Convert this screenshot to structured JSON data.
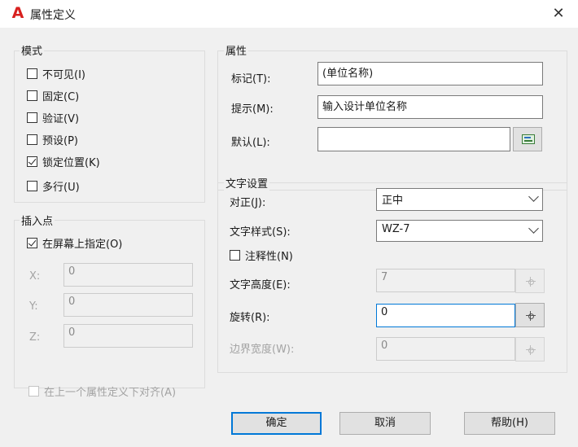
{
  "window": {
    "title": "属性定义",
    "app_icon_letter": "A",
    "close_glyph": "✕"
  },
  "mode": {
    "title": "模式",
    "items": [
      {
        "label": "不可见(I)",
        "checked": false
      },
      {
        "label": "固定(C)",
        "checked": false
      },
      {
        "label": "验证(V)",
        "checked": false
      },
      {
        "label": "预设(P)",
        "checked": false
      },
      {
        "label": "锁定位置(K)",
        "checked": true
      },
      {
        "label": "多行(U)",
        "checked": false
      }
    ]
  },
  "insert_point": {
    "title": "插入点",
    "on_screen_label": "在屏幕上指定(O)",
    "on_screen_checked": true,
    "x_label": "X:",
    "x_value": "0",
    "y_label": "Y:",
    "y_value": "0",
    "z_label": "Z:",
    "z_value": "0"
  },
  "attribute": {
    "title": "属性",
    "tag_label": "标记(T):",
    "tag_value": "(单位名称)",
    "prompt_label": "提示(M):",
    "prompt_value": "输入设计单位名称",
    "default_label": "默认(L):",
    "default_value": ""
  },
  "text_settings": {
    "title": "文字设置",
    "justify_label": "对正(J):",
    "justify_value": "正中",
    "style_label": "文字样式(S):",
    "style_value": "WZ-7",
    "annotative_label": "注释性(N)",
    "annotative_checked": false,
    "height_label": "文字高度(E):",
    "height_value": "7",
    "rotation_label": "旋转(R):",
    "rotation_value": "0",
    "boundary_label": "边界宽度(W):",
    "boundary_value": "0"
  },
  "align_below": {
    "label": "在上一个属性定义下对齐(A)",
    "checked": false
  },
  "buttons": {
    "ok": "确定",
    "cancel": "取消",
    "help": "帮助(H)"
  }
}
